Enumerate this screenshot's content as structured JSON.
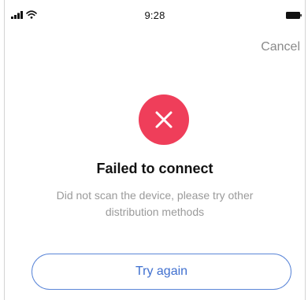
{
  "status_bar": {
    "time": "9:28",
    "signal_icon": "cellular-signal-icon",
    "wifi_icon": "wifi-icon",
    "battery_icon": "battery-icon"
  },
  "header": {
    "cancel_label": "Cancel"
  },
  "error": {
    "icon": "close-icon",
    "icon_color": "#ef3e5a",
    "title": "Failed to connect",
    "message": "Did not scan the device, please try other distribution methods"
  },
  "actions": {
    "try_again_label": "Try again",
    "accent_color": "#3f6fcf"
  }
}
